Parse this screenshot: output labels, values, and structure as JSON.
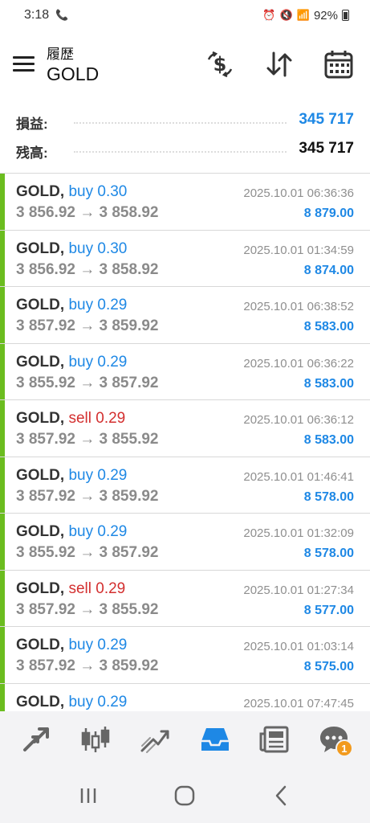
{
  "status_bar": {
    "time": "3:18",
    "battery": "92%"
  },
  "header": {
    "subtitle": "履歴",
    "title": "GOLD"
  },
  "summary": {
    "profit_label": "損益:",
    "profit_value": "345 717",
    "balance_label": "残高:",
    "balance_value": "345 717"
  },
  "deals": [
    {
      "symbol": "GOLD,",
      "type": "buy",
      "volume": "0.30",
      "prices": "3 856.92 → 3 858.92",
      "time": "2025.10.01 06:36:36",
      "profit": "8 879.00"
    },
    {
      "symbol": "GOLD,",
      "type": "buy",
      "volume": "0.30",
      "prices": "3 856.92 → 3 858.92",
      "time": "2025.10.01 01:34:59",
      "profit": "8 874.00"
    },
    {
      "symbol": "GOLD,",
      "type": "buy",
      "volume": "0.29",
      "prices": "3 857.92 → 3 859.92",
      "time": "2025.10.01 06:38:52",
      "profit": "8 583.00"
    },
    {
      "symbol": "GOLD,",
      "type": "buy",
      "volume": "0.29",
      "prices": "3 855.92 → 3 857.92",
      "time": "2025.10.01 06:36:22",
      "profit": "8 583.00"
    },
    {
      "symbol": "GOLD,",
      "type": "sell",
      "volume": "0.29",
      "prices": "3 857.92 → 3 855.92",
      "time": "2025.10.01 06:36:12",
      "profit": "8 583.00"
    },
    {
      "symbol": "GOLD,",
      "type": "buy",
      "volume": "0.29",
      "prices": "3 857.92 → 3 859.92",
      "time": "2025.10.01 01:46:41",
      "profit": "8 578.00"
    },
    {
      "symbol": "GOLD,",
      "type": "buy",
      "volume": "0.29",
      "prices": "3 855.92 → 3 857.92",
      "time": "2025.10.01 01:32:09",
      "profit": "8 578.00"
    },
    {
      "symbol": "GOLD,",
      "type": "sell",
      "volume": "0.29",
      "prices": "3 857.92 → 3 855.92",
      "time": "2025.10.01 01:27:34",
      "profit": "8 577.00"
    },
    {
      "symbol": "GOLD,",
      "type": "buy",
      "volume": "0.29",
      "prices": "3 857.92 → 3 859.92",
      "time": "2025.10.01 01:03:14",
      "profit": "8 575.00"
    },
    {
      "symbol": "GOLD,",
      "type": "buy",
      "volume": "0.29",
      "prices": "",
      "time": "2025.10.01 07:47:45",
      "profit": ""
    }
  ],
  "bottom_nav": {
    "items": [
      {
        "icon": "quotes-arrows-icon"
      },
      {
        "icon": "candlestick-chart-icon"
      },
      {
        "icon": "trade-chart-icon"
      },
      {
        "icon": "history-inbox-icon",
        "active": true
      },
      {
        "icon": "news-icon"
      },
      {
        "icon": "messages-icon",
        "badge": "1"
      }
    ]
  },
  "colors": {
    "accent": "#1e88e5",
    "buy": "#1e88e5",
    "sell": "#d32f2f",
    "row_marker": "#6bbd1f",
    "badge": "#f29a1d"
  }
}
